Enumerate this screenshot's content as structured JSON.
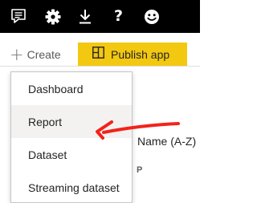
{
  "topbar": {
    "icons": [
      "feedback-icon",
      "gear-icon",
      "download-icon",
      "help-icon",
      "smiley-icon"
    ],
    "help_glyph": "?",
    "background": "#000000"
  },
  "actionbar": {
    "create_label": "Create",
    "create_plus": "+",
    "publish_label": "Publish app",
    "publish_color": "#f2c811"
  },
  "dropdown": {
    "items": [
      {
        "label": "Dashboard"
      },
      {
        "label": "Report"
      },
      {
        "label": "Dataset"
      },
      {
        "label": "Streaming dataset"
      }
    ],
    "highlighted": "Report"
  },
  "background": {
    "sort_label": "Name (A-Z)",
    "column_header": "P"
  },
  "annotation": {
    "arrow_color": "#f2231b"
  }
}
